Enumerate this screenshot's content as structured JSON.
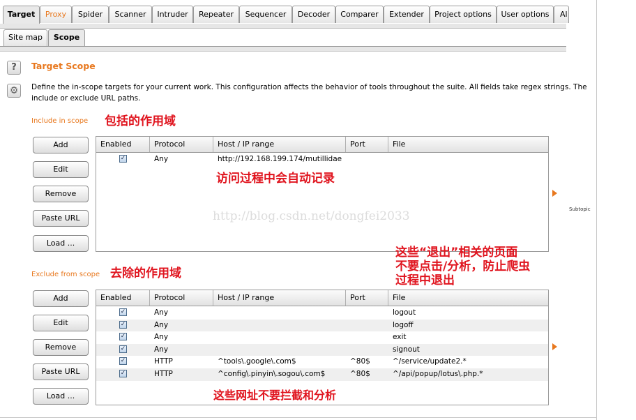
{
  "tabs": [
    "Target",
    "Proxy",
    "Spider",
    "Scanner",
    "Intruder",
    "Repeater",
    "Sequencer",
    "Decoder",
    "Comparer",
    "Extender",
    "Project options",
    "User options",
    "Al"
  ],
  "subtabs": [
    "Site map",
    "Scope"
  ],
  "title": "Target Scope",
  "description_line1": "Define the in-scope targets for your current work. This configuration affects the behavior of tools throughout the suite. All fields take regex strings. The",
  "description_line2": "include or exclude URL paths.",
  "include": {
    "label": "Include in scope",
    "annotation": "包括的作用域",
    "buttons": [
      "Add",
      "Edit",
      "Remove",
      "Paste URL",
      "Load ..."
    ],
    "columns": [
      "Enabled",
      "Protocol",
      "Host / IP range",
      "Port",
      "File"
    ],
    "rows": [
      {
        "enabled": true,
        "protocol": "Any",
        "host": "http://192.168.199.174/mutillidae",
        "port": "",
        "file": ""
      }
    ],
    "row_annotation": "访问过程中会自动记录"
  },
  "exclude": {
    "label": "Exclude from scope",
    "annotation": "去除的作用域",
    "buttons": [
      "Add",
      "Edit",
      "Remove",
      "Paste URL",
      "Load ..."
    ],
    "columns": [
      "Enabled",
      "Protocol",
      "Host / IP range",
      "Port",
      "File"
    ],
    "rows": [
      {
        "enabled": true,
        "protocol": "Any",
        "host": "",
        "port": "",
        "file": "logout"
      },
      {
        "enabled": true,
        "protocol": "Any",
        "host": "",
        "port": "",
        "file": "logoff"
      },
      {
        "enabled": true,
        "protocol": "Any",
        "host": "",
        "port": "",
        "file": "exit"
      },
      {
        "enabled": true,
        "protocol": "Any",
        "host": "",
        "port": "",
        "file": "signout"
      },
      {
        "enabled": true,
        "protocol": "HTTP",
        "host": "^tools\\.google\\.com$",
        "port": "^80$",
        "file": "^/service/update2.*"
      },
      {
        "enabled": true,
        "protocol": "HTTP",
        "host": "^config\\.pinyin\\.sogou\\.com$",
        "port": "^80$",
        "file": "^/api/popup/lotus\\.php.*"
      }
    ],
    "side_annotation": [
      "这些“退出”相关的页面",
      "不要点击/分析，防止爬虫",
      "过程中退出"
    ],
    "bottom_annotation": "这些网址不要拦截和分析"
  },
  "watermark": "http://blog.csdn.net/dongfei2033",
  "subtopic": "Subtopic",
  "colors": {
    "accent": "#e8781e",
    "annotation": "#e0141e"
  },
  "icons": {
    "help": "question-mark",
    "settings": "gear"
  }
}
